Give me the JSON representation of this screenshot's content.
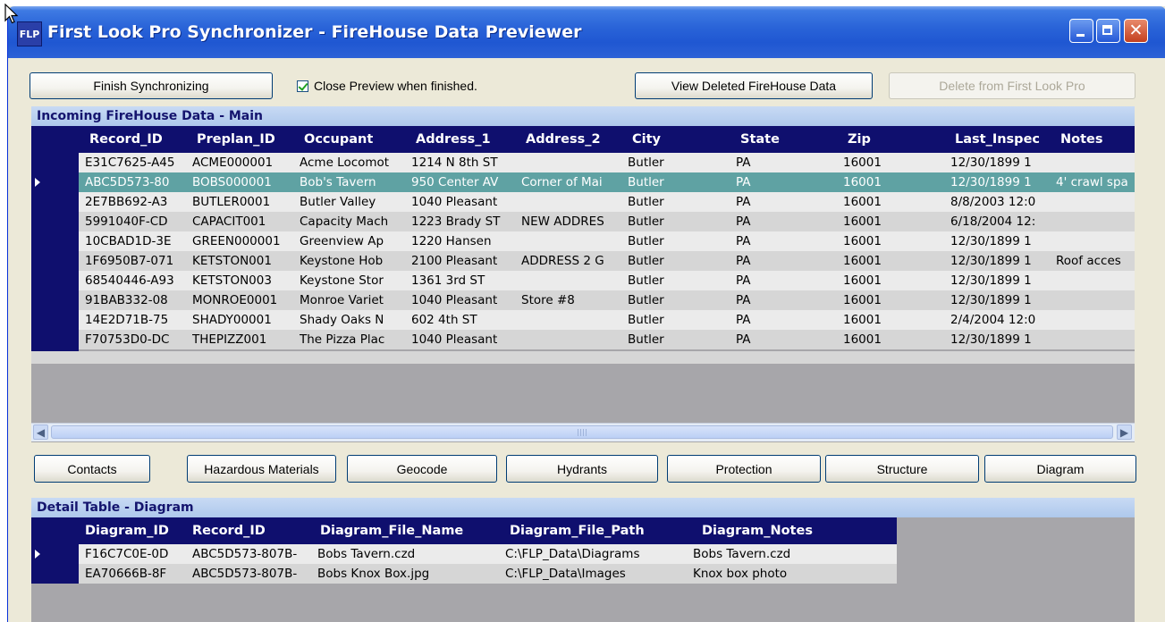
{
  "window": {
    "title": "First Look Pro Synchronizer - FireHouse Data Previewer",
    "icon_label": "FLP"
  },
  "toolbar": {
    "finish_label": "Finish Synchronizing",
    "close_preview_label": "Close Preview when finished.",
    "close_preview_checked": true,
    "view_deleted_label": "View Deleted FireHouse Data",
    "delete_label": "Delete from First Look Pro"
  },
  "main_grid": {
    "title": "Incoming FireHouse Data - Main",
    "columns": [
      "Record_ID",
      "Preplan_ID",
      "Occupant",
      "Address_1",
      "Address_2",
      "City",
      "State",
      "Zip",
      "Last_Inspec",
      "Notes"
    ],
    "selected_row": 1,
    "rows": [
      [
        "E31C7625-A45",
        "ACME000001",
        "Acme Locomot",
        "1214 N 8th ST",
        "",
        "Butler",
        "PA",
        "16001",
        "12/30/1899 1",
        ""
      ],
      [
        "ABC5D573-80",
        "BOBS000001",
        "Bob's Tavern",
        "950 Center AV",
        "Corner of Mai",
        "Butler",
        "PA",
        "16001",
        "12/30/1899 1",
        "4' crawl spa"
      ],
      [
        "2E7BB692-A3",
        "BUTLER0001",
        "Butler Valley",
        "1040 Pleasant",
        "",
        "Butler",
        "PA",
        "16001",
        "8/8/2003 12:0",
        ""
      ],
      [
        "5991040F-CD",
        "CAPACIT001",
        "Capacity Mach",
        "1223 Brady ST",
        "NEW ADDRES",
        "Butler",
        "PA",
        "16001",
        "6/18/2004 12:",
        ""
      ],
      [
        "10CBAD1D-3E",
        "GREEN000001",
        "Greenview Ap",
        "1220 Hansen",
        "",
        "Butler",
        "PA",
        "16001",
        "12/30/1899 1",
        ""
      ],
      [
        "1F6950B7-071",
        "KETSTON001",
        "Keystone Hob",
        "2100 Pleasant",
        "ADDRESS 2 G",
        "Butler",
        "PA",
        "16001",
        "12/30/1899 1",
        "Roof acces"
      ],
      [
        "68540446-A93",
        "KETSTON003",
        "Keystone Stor",
        "1361 3rd ST",
        "",
        "Butler",
        "PA",
        "16001",
        "12/30/1899 1",
        ""
      ],
      [
        "91BAB332-08",
        "MONROE0001",
        "Monroe Variet",
        "1040 Pleasant",
        "Store #8",
        "Butler",
        "PA",
        "16001",
        "12/30/1899 1",
        ""
      ],
      [
        "14E2D71B-75",
        "SHADY00001",
        "Shady Oaks N",
        "602 4th ST",
        "",
        "Butler",
        "PA",
        "16001",
        "2/4/2004 12:0",
        ""
      ],
      [
        "F70753D0-DC",
        "THEPIZZ001",
        "The Pizza Plac",
        "1040 Pleasant",
        "",
        "Butler",
        "PA",
        "16001",
        "12/30/1899 1",
        ""
      ]
    ]
  },
  "detail_buttons": [
    "Contacts",
    "Hazardous Materials",
    "Geocode",
    "Hydrants",
    "Protection",
    "Structure",
    "Diagram"
  ],
  "detail_grid": {
    "title": "Detail Table - Diagram",
    "columns": [
      "Diagram_ID",
      "Record_ID",
      "Diagram_File_Name",
      "Diagram_File_Path",
      "Diagram_Notes"
    ],
    "selected_row": 0,
    "rows": [
      [
        "F16C7C0E-0D",
        "ABC5D573-807B-",
        "Bobs Tavern.czd",
        "C:\\FLP_Data\\Diagrams",
        "Bobs Tavern.czd"
      ],
      [
        "EA70666B-8F",
        "ABC5D573-807B-",
        "Bobs Knox Box.jpg",
        "C:\\FLP_Data\\Images",
        "Knox box photo"
      ]
    ]
  },
  "icons": {
    "scroll_left": "◀",
    "scroll_right": "▶",
    "row_pointer": "row-indicator-arrow"
  },
  "colors": {
    "title_bar": "#2a64d8",
    "grid_header": "#0f0f6e",
    "selected_row": "#5fa2a3",
    "panel_header": "#c0d4f2"
  }
}
